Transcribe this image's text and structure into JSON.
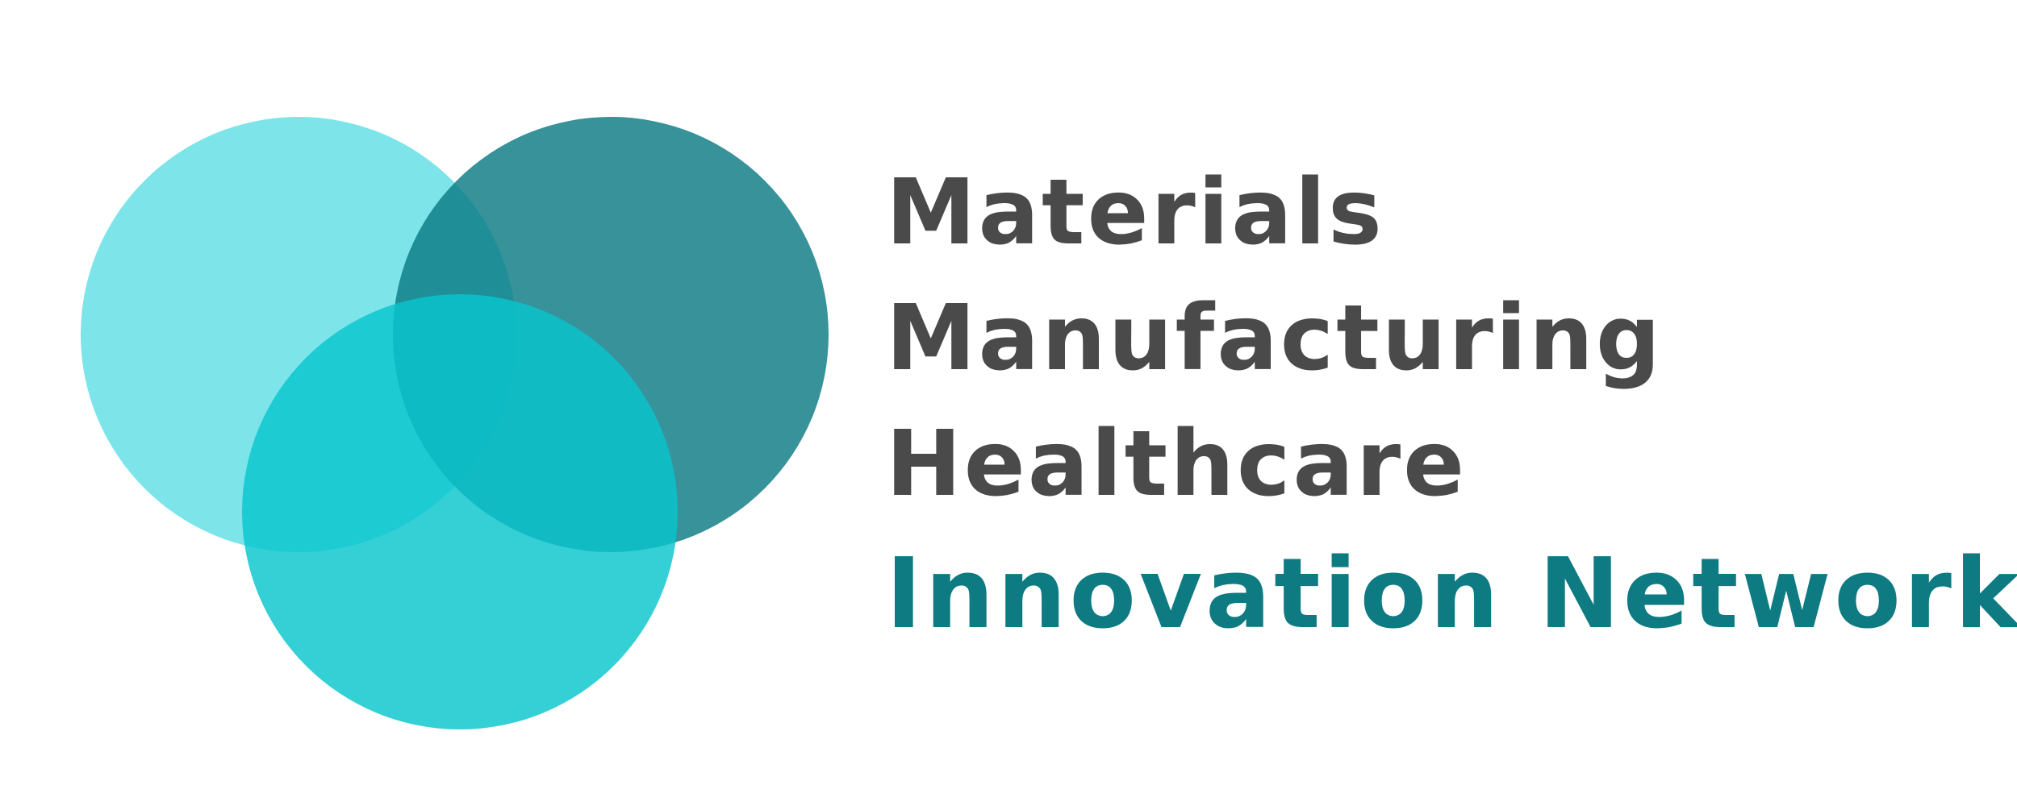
{
  "logo": {
    "circles": [
      {
        "name": "light-cyan-circle",
        "color": "#6fe2e7"
      },
      {
        "name": "dark-teal-circle",
        "color": "#227f88"
      },
      {
        "name": "cyan-circle",
        "color": "#16c8d0"
      }
    ]
  },
  "wordmark": {
    "line1": "Materials",
    "line2": "Manufacturing",
    "line3": "Healthcare",
    "line4": "Innovation Network",
    "text_color": "#4a4a4a",
    "accent_color": "#0e7a82"
  }
}
